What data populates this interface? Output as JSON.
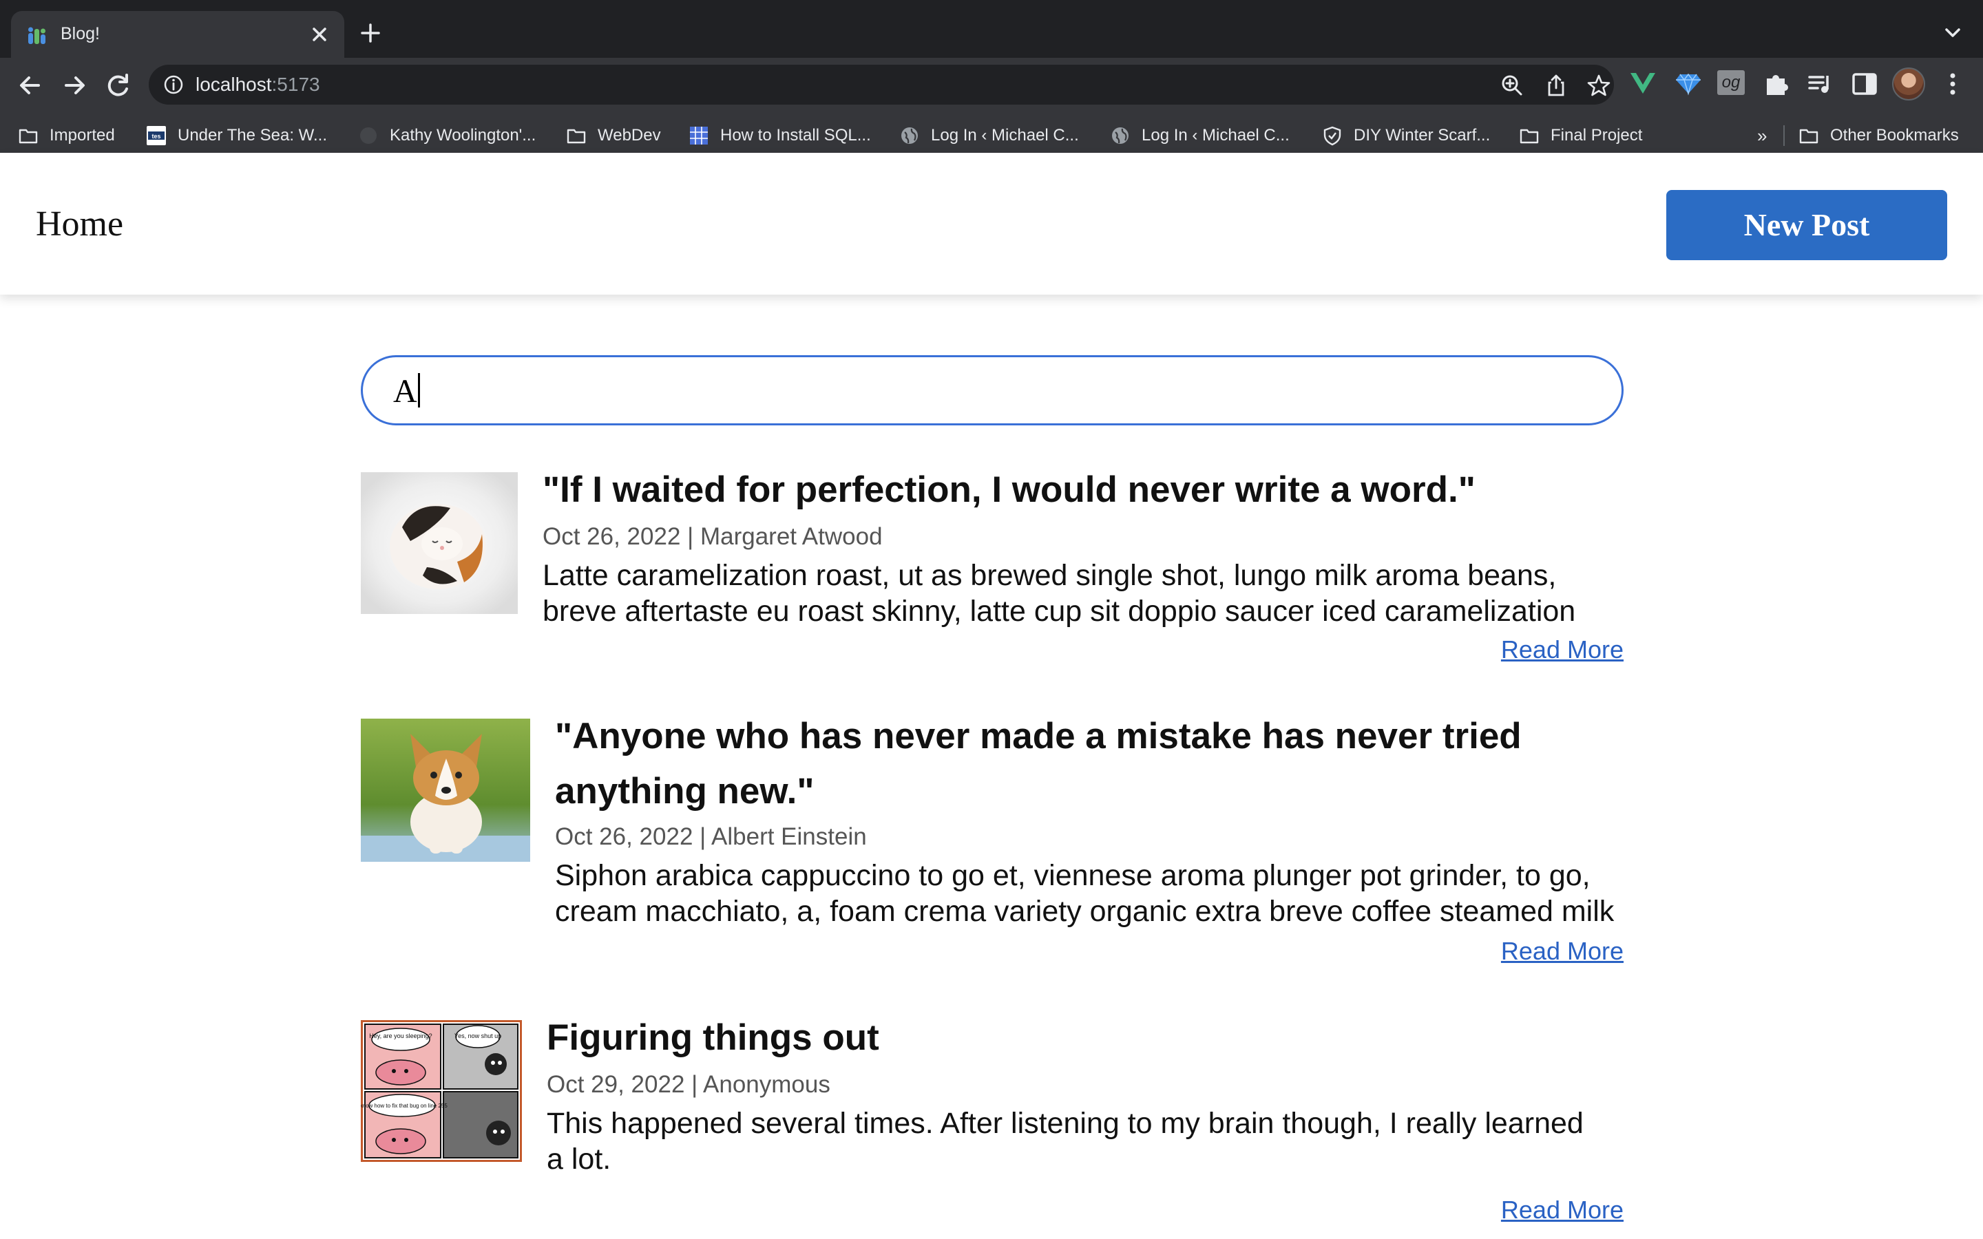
{
  "browser": {
    "tab_title": "Blog!",
    "url_host": "localhost",
    "url_port": ":5173",
    "bookmarks": [
      {
        "label": "Imported",
        "icon": "folder-icon"
      },
      {
        "label": "Under The Sea: W...",
        "icon": "tes-icon"
      },
      {
        "label": "Kathy Woolington'...",
        "icon": "globe-icon"
      },
      {
        "label": "WebDev",
        "icon": "folder-icon"
      },
      {
        "label": "How to Install SQL...",
        "icon": "grid-icon"
      },
      {
        "label": "Log In ‹ Michael C...",
        "icon": "globe-icon"
      },
      {
        "label": "Log In ‹ Michael C...",
        "icon": "globe-icon"
      },
      {
        "label": "DIY Winter Scarf...",
        "icon": "shield-icon"
      },
      {
        "label": "Final Project",
        "icon": "folder-icon"
      }
    ],
    "more_bookmarks": "»",
    "other_bookmarks": "Other Bookmarks",
    "extension_og": "og"
  },
  "header": {
    "home_label": "Home",
    "new_post_label": "New Post"
  },
  "search": {
    "value": "A"
  },
  "posts": [
    {
      "title": "\"If I waited for perfection, I would never write a word.\"",
      "meta": "Oct 26, 2022 | Margaret Atwood",
      "body_line1": "Latte caramelization roast, ut as brewed single shot, lungo milk aroma beans,",
      "body_line2": "breve aftertaste eu roast skinny, latte cup sit doppio saucer iced caramelization",
      "read_more": "Read More",
      "image": "kitten-image"
    },
    {
      "title_line1": "\"Anyone who has never made a mistake has never tried",
      "title_line2": "anything new.\"",
      "meta": "Oct 26, 2022 | Albert Einstein",
      "body_line1": "Siphon arabica cappuccino to go et, viennese aroma plunger pot grinder, to go,",
      "body_line2": "cream macchiato, a, foam crema variety organic extra breve coffee steamed milk",
      "read_more": "Read More",
      "image": "corgi-puppy-image"
    },
    {
      "title": "Figuring things out",
      "meta": "Oct 29, 2022 | Anonymous",
      "body_line1": "This happened several times. After listening to my brain though, I really learned",
      "body_line2": "a lot.",
      "read_more": "Read More",
      "image": "brain-comic-image",
      "comic_text": [
        "Hey, are you sleeping?",
        "Yes, now shut up",
        "I know how to fix that bug on line 255"
      ]
    }
  ],
  "colors": {
    "accent": "#2b6cc4",
    "link": "#2a62c4",
    "search_border": "#3a70d8",
    "chrome_dark": "#202124",
    "chrome_toolbar": "#35363a"
  }
}
